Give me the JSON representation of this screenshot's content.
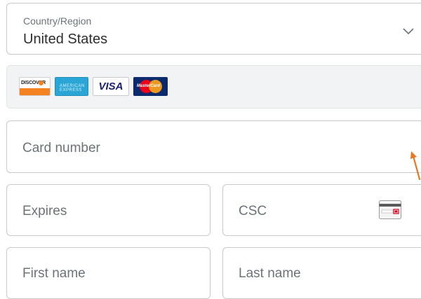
{
  "country": {
    "label": "Country/Region",
    "value": "United States",
    "chevron_icon": "chevron-down-icon"
  },
  "accepted_cards": [
    {
      "name": "discover",
      "text": "DISCOVER"
    },
    {
      "name": "amex",
      "text": "AMERICAN EXPRESS"
    },
    {
      "name": "visa",
      "text": "VISA"
    },
    {
      "name": "mastercard",
      "text": "MasterCard"
    }
  ],
  "card_number": {
    "placeholder": "Card number"
  },
  "expires": {
    "placeholder": "Expires"
  },
  "csc": {
    "placeholder": "CSC",
    "icon": "card-back-icon"
  },
  "first_name": {
    "placeholder": "First name"
  },
  "last_name": {
    "placeholder": "Last name"
  },
  "colors": {
    "border": "#c9c9c9",
    "placeholder_text": "#6c7378",
    "value_text": "#2c2e2f",
    "cards_bar_bg": "#f2f3f4",
    "cursor_arrow": "#e87722"
  }
}
